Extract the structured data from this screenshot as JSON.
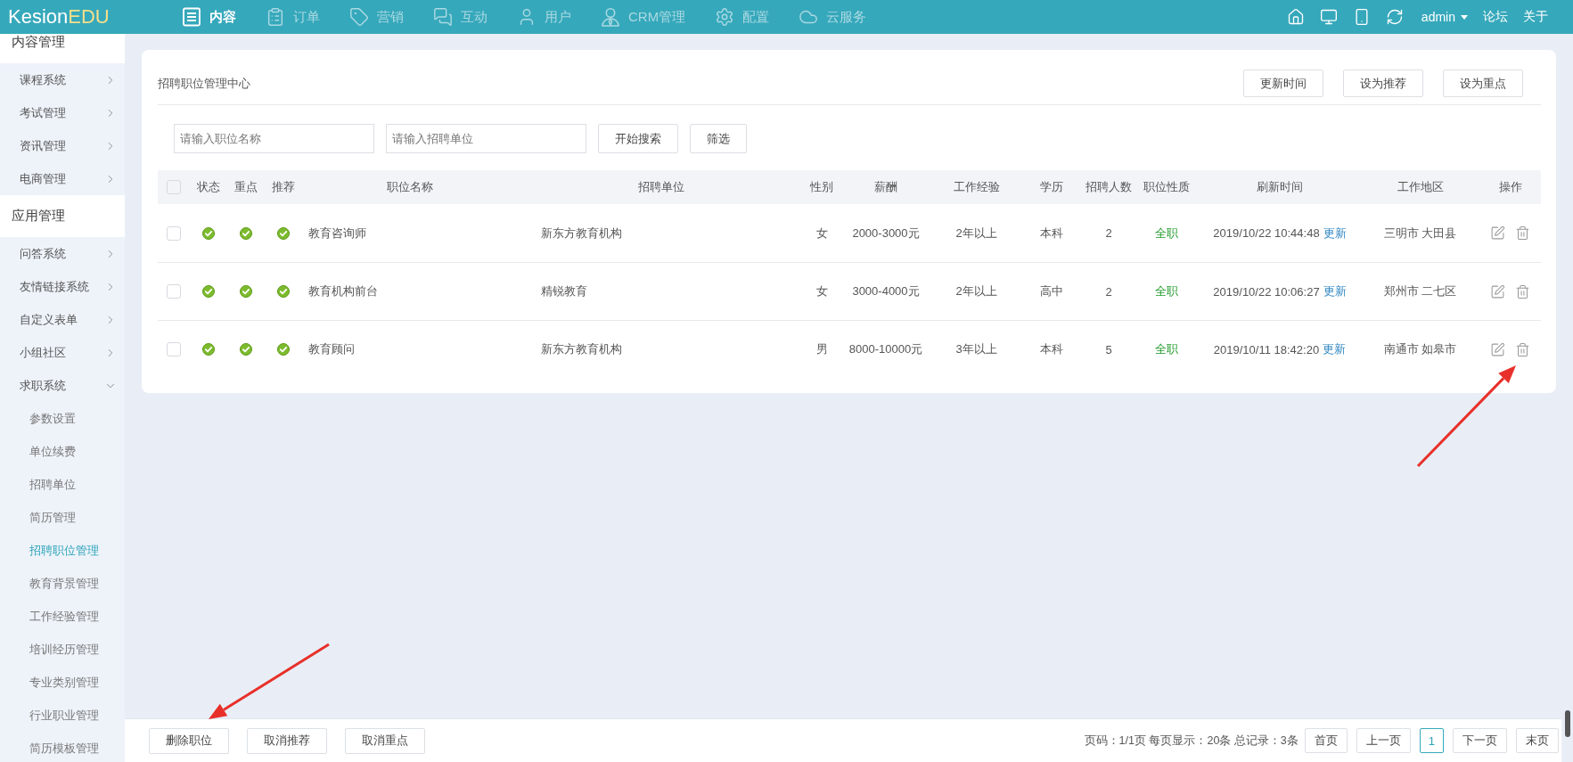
{
  "topbar": {
    "logo": {
      "text": "Kesion",
      "accent": "EDU"
    },
    "nav": [
      {
        "label": "内容",
        "selected": true
      },
      {
        "label": "订单",
        "selected": false
      },
      {
        "label": "营销",
        "selected": false
      },
      {
        "label": "互动",
        "selected": false
      },
      {
        "label": "用户",
        "selected": false
      },
      {
        "label": "CRM管理",
        "selected": false
      },
      {
        "label": "配置",
        "selected": false
      },
      {
        "label": "云服务",
        "selected": false
      }
    ],
    "user": "admin",
    "links": [
      "论坛",
      "关于"
    ]
  },
  "sidebar": {
    "sections": [
      {
        "title": "内容管理",
        "items": [
          {
            "label": "课程系统",
            "expanded": false
          },
          {
            "label": "考试管理",
            "expanded": false
          },
          {
            "label": "资讯管理",
            "expanded": false
          },
          {
            "label": "电商管理",
            "expanded": false
          }
        ]
      },
      {
        "title": "应用管理",
        "items": [
          {
            "label": "问答系统",
            "expanded": false
          },
          {
            "label": "友情链接系统",
            "expanded": false
          },
          {
            "label": "自定义表单",
            "expanded": false
          },
          {
            "label": "小组社区",
            "expanded": false
          },
          {
            "label": "求职系统",
            "expanded": true,
            "children": [
              {
                "label": "参数设置",
                "selected": false
              },
              {
                "label": "单位续费",
                "selected": false
              },
              {
                "label": "招聘单位",
                "selected": false
              },
              {
                "label": "简历管理",
                "selected": false
              },
              {
                "label": "招聘职位管理",
                "selected": true
              },
              {
                "label": "教育背景管理",
                "selected": false
              },
              {
                "label": "工作经验管理",
                "selected": false
              },
              {
                "label": "培训经历管理",
                "selected": false
              },
              {
                "label": "专业类别管理",
                "selected": false
              },
              {
                "label": "行业职业管理",
                "selected": false
              },
              {
                "label": "简历模板管理",
                "selected": false
              }
            ]
          }
        ]
      }
    ]
  },
  "card": {
    "title": "招聘职位管理中心",
    "actions": [
      "更新时间",
      "设为推荐",
      "设为重点"
    ],
    "search": {
      "fields": [
        {
          "placeholder": "请输入职位名称"
        },
        {
          "placeholder": "请输入招聘单位"
        }
      ],
      "buttons": [
        "开始搜索",
        "筛选"
      ]
    }
  },
  "table": {
    "header_checked": false,
    "columns": [
      "状态",
      "重点",
      "推荐",
      "职位名称",
      "招聘单位",
      "性别",
      "薪酬",
      "工作经验",
      "学历",
      "招聘人数",
      "职位性质",
      "刷新时间",
      "工作地区",
      "操作"
    ],
    "rows": [
      {
        "checked": false,
        "active": true,
        "featured": true,
        "recommended": true,
        "title": "教育咨询师",
        "company": "新东方教育机构",
        "gender": "女",
        "salary": "2000-3000元",
        "experience": "2年以上",
        "education": "本科",
        "openings": "2",
        "job_type": "全职",
        "refreshed": "2019/10/22 10:44:48",
        "refresh_link": "更新",
        "location": "三明市 大田县"
      },
      {
        "checked": false,
        "active": true,
        "featured": true,
        "recommended": true,
        "title": "教育机构前台",
        "company": "精锐教育",
        "gender": "女",
        "salary": "3000-4000元",
        "experience": "2年以上",
        "education": "高中",
        "openings": "2",
        "job_type": "全职",
        "refreshed": "2019/10/22 10:06:27",
        "refresh_link": "更新",
        "location": "郑州市 二七区"
      },
      {
        "checked": false,
        "active": true,
        "featured": true,
        "recommended": true,
        "title": "教育顾问",
        "company": "新东方教育机构",
        "gender": "男",
        "salary": "8000-10000元",
        "experience": "3年以上",
        "education": "本科",
        "openings": "5",
        "job_type": "全职",
        "refreshed": "2019/10/11 18:42:20",
        "refresh_link": "更新",
        "location": "南通市 如皋市"
      }
    ]
  },
  "footer": {
    "buttons": [
      "删除职位",
      "取消推荐",
      "取消重点"
    ],
    "summary": "页码：1/1页 每页显示：20条 总记录：3条",
    "pager": [
      {
        "label": "首页",
        "selected": false
      },
      {
        "label": "上一页",
        "selected": false
      },
      {
        "label": "1",
        "selected": true
      },
      {
        "label": "下一页",
        "selected": false
      },
      {
        "label": "末页",
        "selected": false
      }
    ]
  }
}
